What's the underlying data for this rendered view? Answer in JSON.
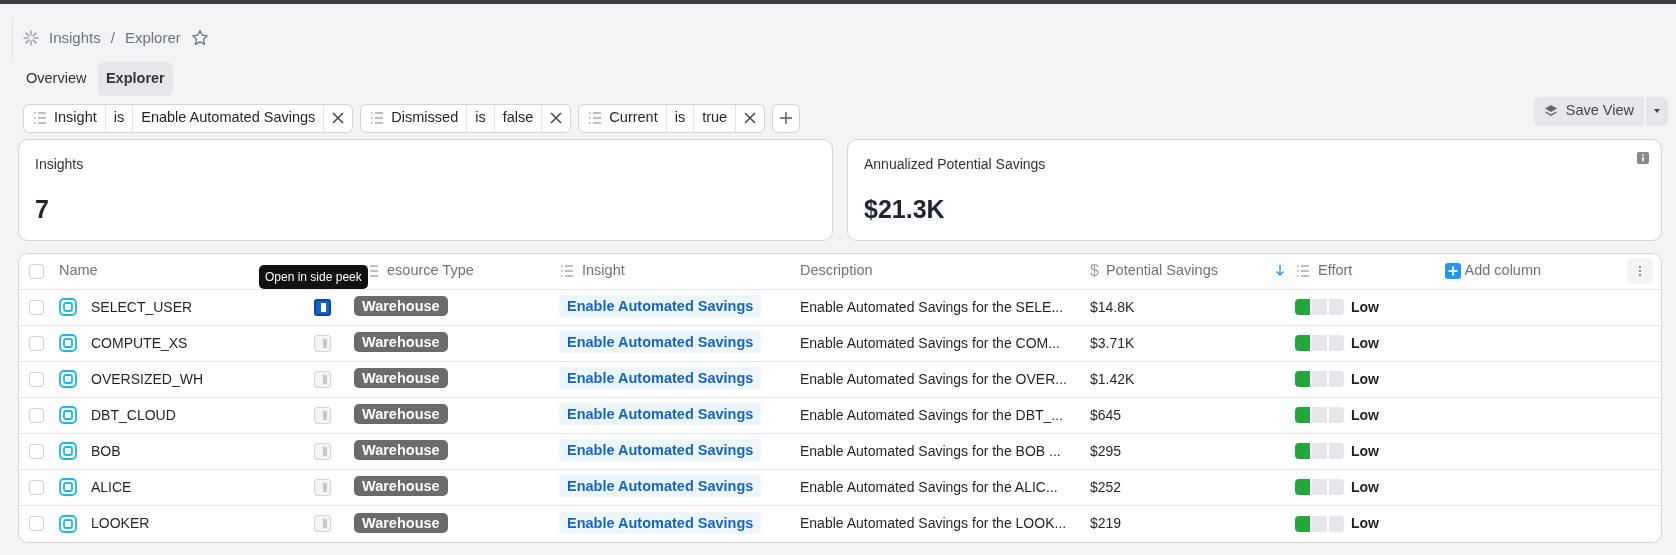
{
  "breadcrumb": {
    "items": [
      "Insights",
      "Explorer"
    ],
    "separator": "/",
    "starred": false
  },
  "tabs": [
    {
      "label": "Overview",
      "selected": false
    },
    {
      "label": "Explorer",
      "selected": true
    }
  ],
  "filters": [
    {
      "field": "Insight",
      "operator": "is",
      "value": "Enable Automated Savings"
    },
    {
      "field": "Dismissed",
      "operator": "is",
      "value": "false"
    },
    {
      "field": "Current",
      "operator": "is",
      "value": "true"
    }
  ],
  "save_view": {
    "label": "Save View"
  },
  "metrics": [
    {
      "label": "Insights",
      "value": "7",
      "info": false
    },
    {
      "label": "Annualized Potential Savings",
      "value": "$21.3K",
      "info": true
    }
  ],
  "table": {
    "all_checked": false,
    "columns": [
      {
        "label": "Name",
        "kind": "plain"
      },
      {
        "label": "esource Type",
        "kind": "list"
      },
      {
        "label": "Insight",
        "kind": "list"
      },
      {
        "label": "Description",
        "kind": "plain"
      },
      {
        "label": "Potential Savings",
        "kind": "money",
        "prefix": "$",
        "sorted": true
      },
      {
        "label": "Effort",
        "kind": "list"
      }
    ],
    "add_column": "Add column",
    "tooltip": "Open in side peek",
    "rows": [
      {
        "checked": false,
        "name": "SELECT_USER",
        "peek_highlighted": true,
        "resource_type": "Warehouse",
        "insight": "Enable Automated Savings",
        "description": "Enable Automated Savings for the SELE...",
        "savings": "$14.8K",
        "level": 0.333,
        "effort": "Low"
      },
      {
        "checked": false,
        "name": "COMPUTE_XS",
        "peek_highlighted": false,
        "resource_type": "Warehouse",
        "insight": "Enable Automated Savings",
        "description": "Enable Automated Savings for the COM...",
        "savings": "$3.71K",
        "level": 0.333,
        "effort": "Low"
      },
      {
        "checked": false,
        "name": "OVERSIZED_WH",
        "peek_highlighted": false,
        "resource_type": "Warehouse",
        "insight": "Enable Automated Savings",
        "description": "Enable Automated Savings for the OVER...",
        "savings": "$1.42K",
        "level": 0.333,
        "effort": "Low"
      },
      {
        "checked": false,
        "name": "DBT_CLOUD",
        "peek_highlighted": false,
        "resource_type": "Warehouse",
        "insight": "Enable Automated Savings",
        "description": "Enable Automated Savings for the DBT_...",
        "savings": "$645",
        "level": 0.333,
        "effort": "Low"
      },
      {
        "checked": false,
        "name": "BOB",
        "peek_highlighted": false,
        "resource_type": "Warehouse",
        "insight": "Enable Automated Savings",
        "description": "Enable Automated Savings for the BOB ...",
        "savings": "$295",
        "level": 0.333,
        "effort": "Low"
      },
      {
        "checked": false,
        "name": "ALICE",
        "peek_highlighted": false,
        "resource_type": "Warehouse",
        "insight": "Enable Automated Savings",
        "description": "Enable Automated Savings for the ALIC...",
        "savings": "$252",
        "level": 0.333,
        "effort": "Low"
      },
      {
        "checked": false,
        "name": "LOOKER",
        "peek_highlighted": false,
        "resource_type": "Warehouse",
        "insight": "Enable Automated Savings",
        "description": "Enable Automated Savings for the LOOK...",
        "savings": "$219",
        "level": 0.333,
        "effort": "Low"
      }
    ]
  }
}
